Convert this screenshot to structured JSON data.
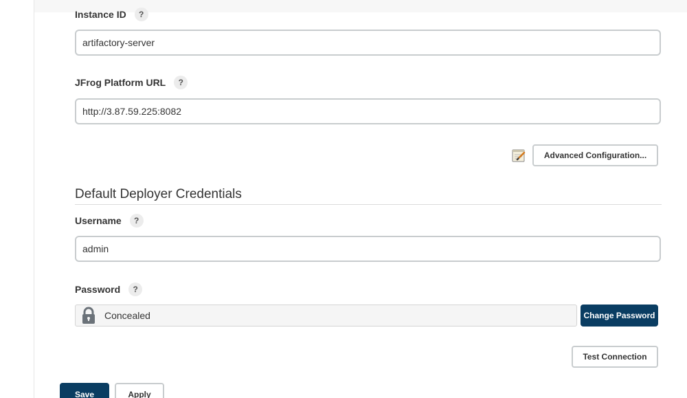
{
  "form": {
    "instance_id": {
      "label": "Instance ID",
      "help": "?",
      "value": "artifactory-server"
    },
    "platform_url": {
      "label": "JFrog Platform URL",
      "help": "?",
      "value": "http://3.87.59.225:8082"
    },
    "advanced_button": "Advanced Configuration...",
    "advanced_icon": "notepad-pencil-icon"
  },
  "credentials": {
    "section_title": "Default Deployer Credentials",
    "username": {
      "label": "Username",
      "help": "?",
      "value": "admin"
    },
    "password": {
      "label": "Password",
      "help": "?",
      "value": "Concealed",
      "icon": "lock-icon",
      "change_button": "Change Password"
    },
    "test_button": "Test Connection"
  },
  "footer": {
    "save_label": "Save",
    "apply_label": "Apply"
  },
  "colors": {
    "primary": "#0a3d62",
    "border": "#c8ccce",
    "text": "#333333"
  }
}
